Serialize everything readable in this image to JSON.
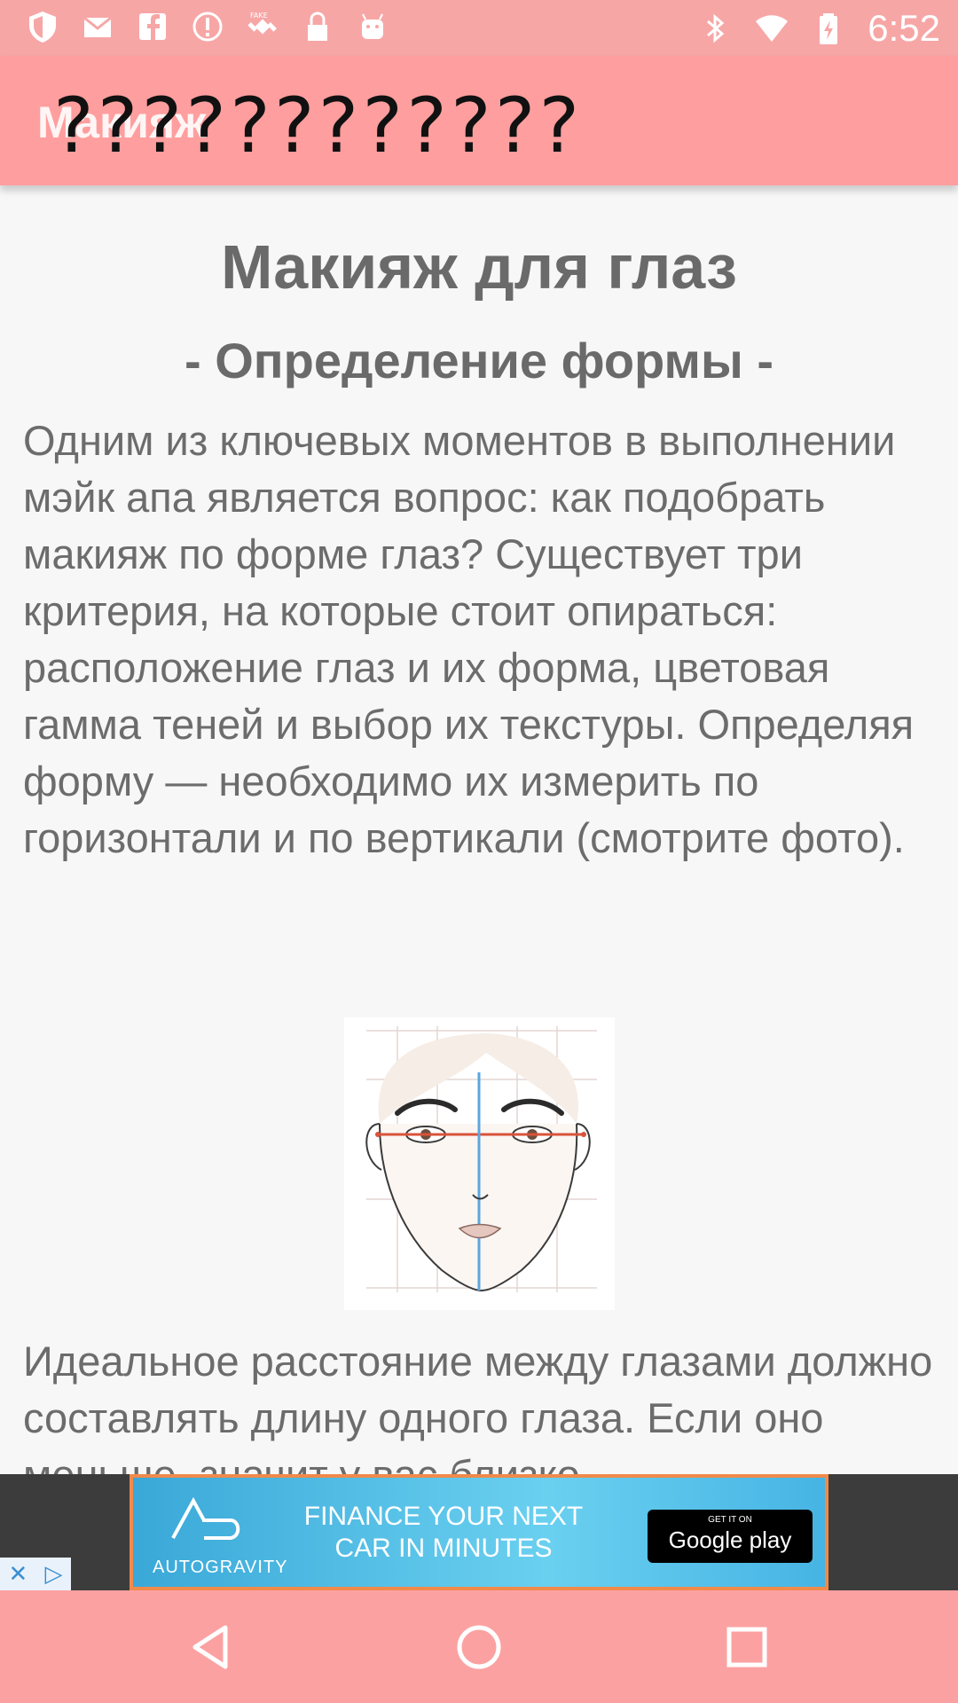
{
  "status_bar": {
    "time": "6:52",
    "left_icons": [
      "shield-icon",
      "mail-icon",
      "facebook-icon",
      "info-icon",
      "fake-gps-icon",
      "lock-icon",
      "android-icon"
    ],
    "right_icons": [
      "bluetooth-icon",
      "wifi-icon",
      "battery-icon"
    ]
  },
  "app_bar": {
    "title": "Макияж",
    "overlay_text": "????????????"
  },
  "article": {
    "heading": "Макияж для глаз",
    "subheading": "- Определение формы -",
    "paragraph1": "Одним из ключевых моментов в выполнении мэйк апа является вопрос: как подобрать макияж по форме глаз? Существует три критерия, на которые стоит опираться: расположение глаз и их форма, цветовая гамма теней и выбор их текстуры. Определяя форму — необходимо их измерить по горизонтали и по вертикали (смотрите фото).",
    "paragraph2": "Идеальное расстояние между глазами должно составлять длину одного глаза. Если оно меньше, значит у вас близко"
  },
  "ad": {
    "logo_text": "AUTOGRAVITY",
    "headline": "FINANCE YOUR NEXT CAR IN MINUTES",
    "store_badge_small": "GET IT ON",
    "store_badge_big": "Google play",
    "close_glyph": "✕",
    "adchoices_glyph": "▷"
  },
  "nav": {
    "back": "back-icon",
    "home": "home-icon",
    "recents": "recents-icon"
  }
}
